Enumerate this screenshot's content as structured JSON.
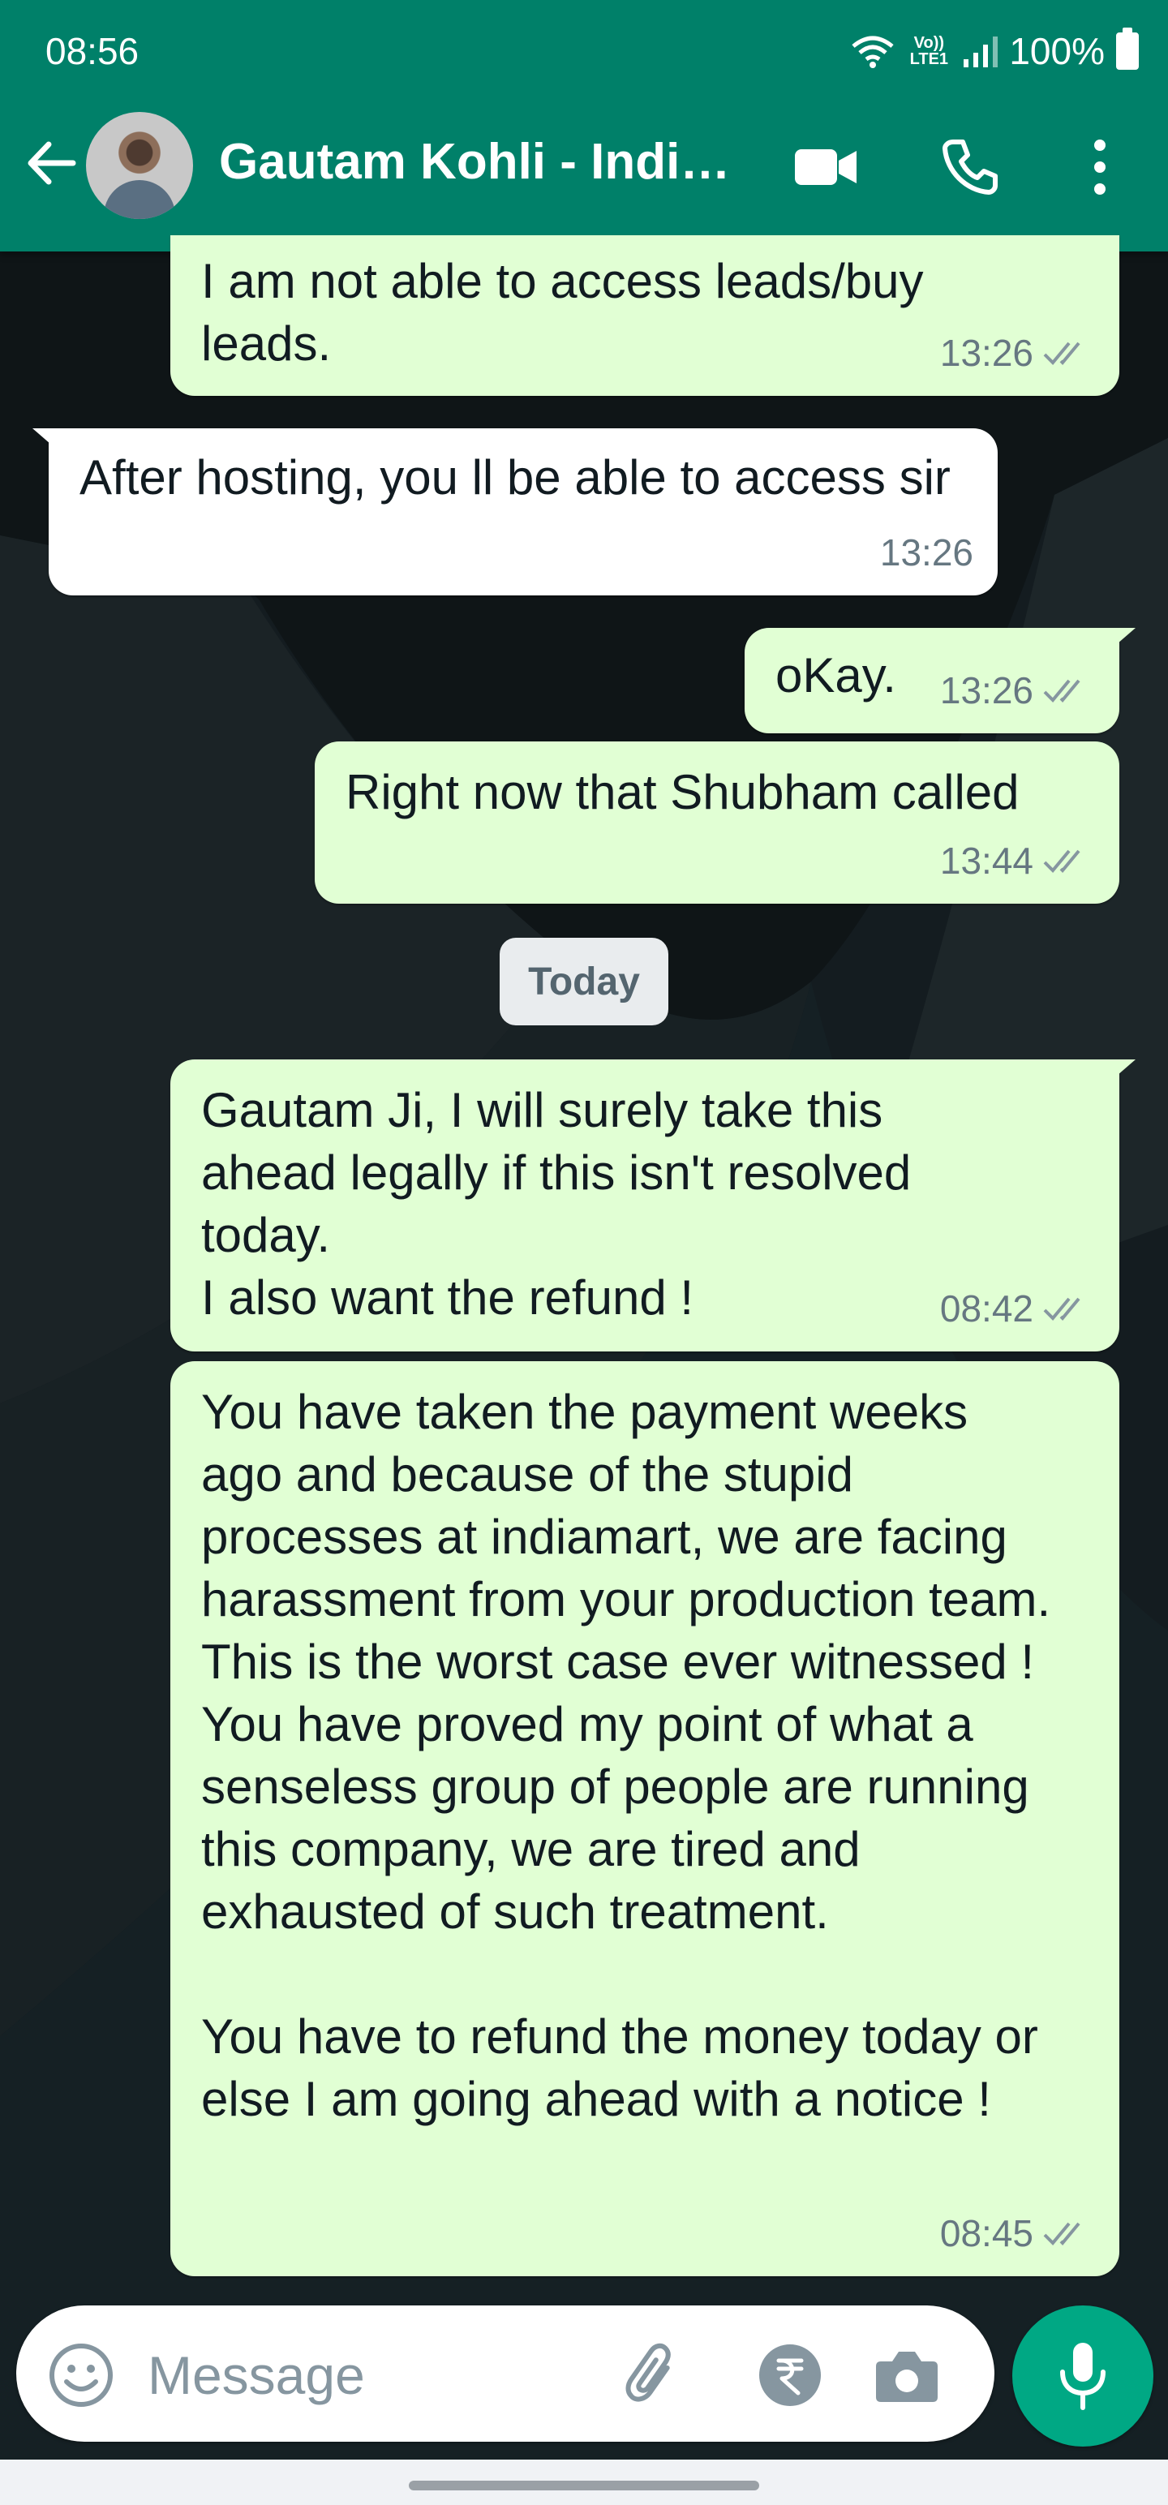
{
  "status_bar": {
    "time": "08:56",
    "network": "Vo)) LTE1",
    "battery": "100%"
  },
  "header": {
    "contact_name": "Gautam Kohli - Indi…"
  },
  "messages": [
    {
      "direction": "out",
      "text": "I am not able to access leads/buy leads.",
      "time": "13:26"
    },
    {
      "direction": "in",
      "text": "After hosting, you ll be able to access sir",
      "time": "13:26"
    },
    {
      "direction": "out",
      "text": "oKay.",
      "time": "13:26"
    },
    {
      "direction": "out",
      "text": "Right now that Shubham called",
      "time": "13:44"
    },
    {
      "direction": "out",
      "text": "Gautam Ji, I will surely take this ahead legally if this isn't resolved today.\nI also want the refund !",
      "time": "08:42"
    },
    {
      "direction": "out",
      "text": "You have taken the payment weeks ago and because of the stupid processes at indiamart, we are facing harassment from your production team. This is the worst case ever witnessed !\nYou have proved my point of what a senseless group of people are running this company, we are tired and exhausted of such treatment.\n\nYou have to refund the money today or else I am going ahead with a notice !",
      "time": "08:45"
    }
  ],
  "date_divider": "Today",
  "composer": {
    "placeholder": "Message"
  },
  "colors": {
    "header": "#008069",
    "outgoing_bubble": "#e1ffd4",
    "incoming_bubble": "#ffffff",
    "mic_button": "#00a884"
  }
}
